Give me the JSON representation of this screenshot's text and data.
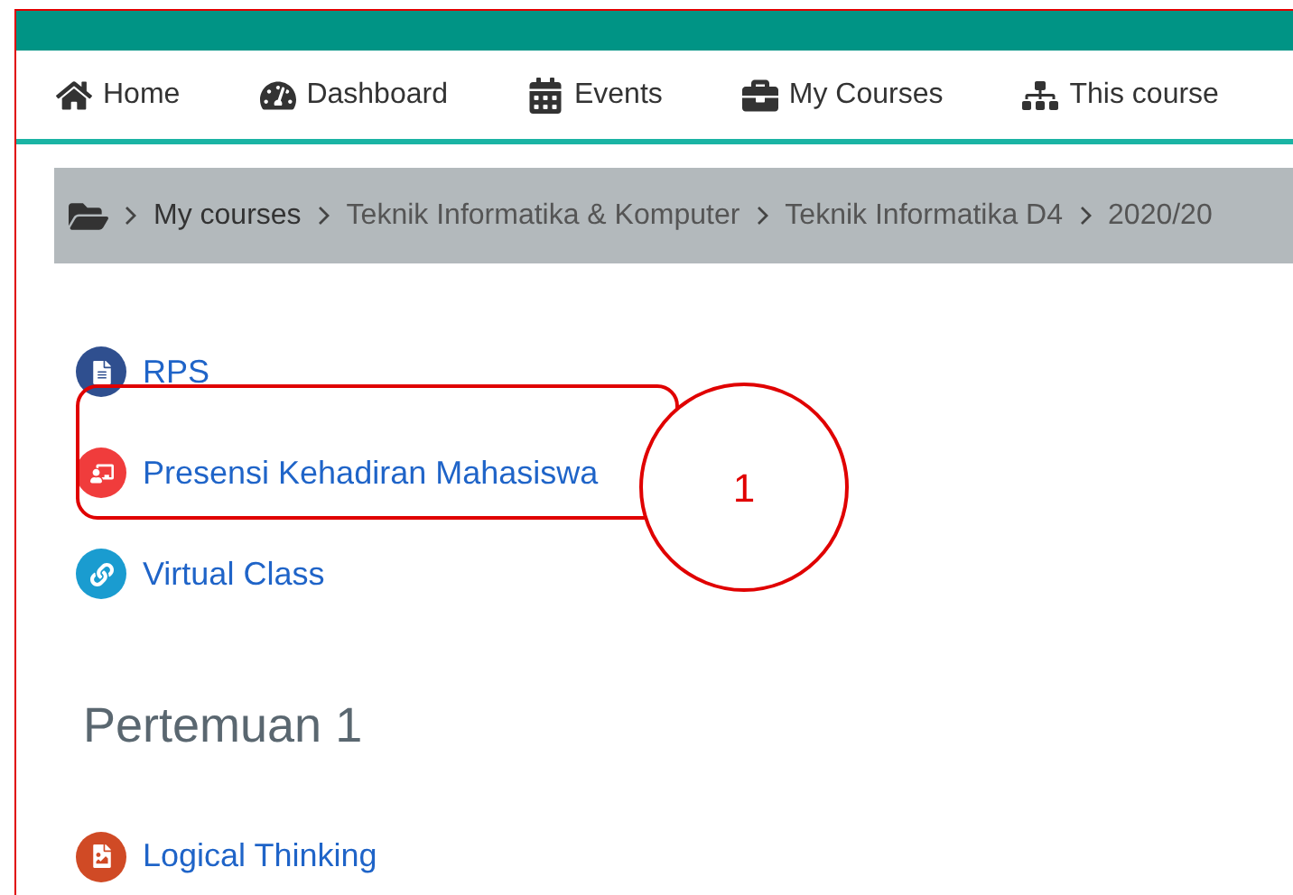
{
  "nav": [
    {
      "label": "Home",
      "kind": "home"
    },
    {
      "label": "Dashboard",
      "kind": "dashboard"
    },
    {
      "label": "Events",
      "kind": "calendar"
    },
    {
      "label": "My Courses",
      "kind": "briefcase"
    },
    {
      "label": "This course",
      "kind": "sitemap"
    }
  ],
  "breadcrumb": [
    "My courses",
    "Teknik Informatika & Komputer",
    "Teknik Informatika D4",
    "2020/20"
  ],
  "activities": [
    {
      "label": "RPS",
      "kind": "document",
      "color": "#2f4f8f"
    },
    {
      "label": "Presensi Kehadiran Mahasiswa",
      "kind": "attendance",
      "color": "#f03c3c"
    },
    {
      "label": "Virtual Class",
      "kind": "link",
      "color": "#1a9cd0"
    }
  ],
  "section": {
    "title": "Pertemuan 1",
    "activities": [
      {
        "label": "Logical Thinking",
        "kind": "file",
        "color": "#d04a25"
      }
    ]
  },
  "annotation": {
    "label": "1"
  }
}
